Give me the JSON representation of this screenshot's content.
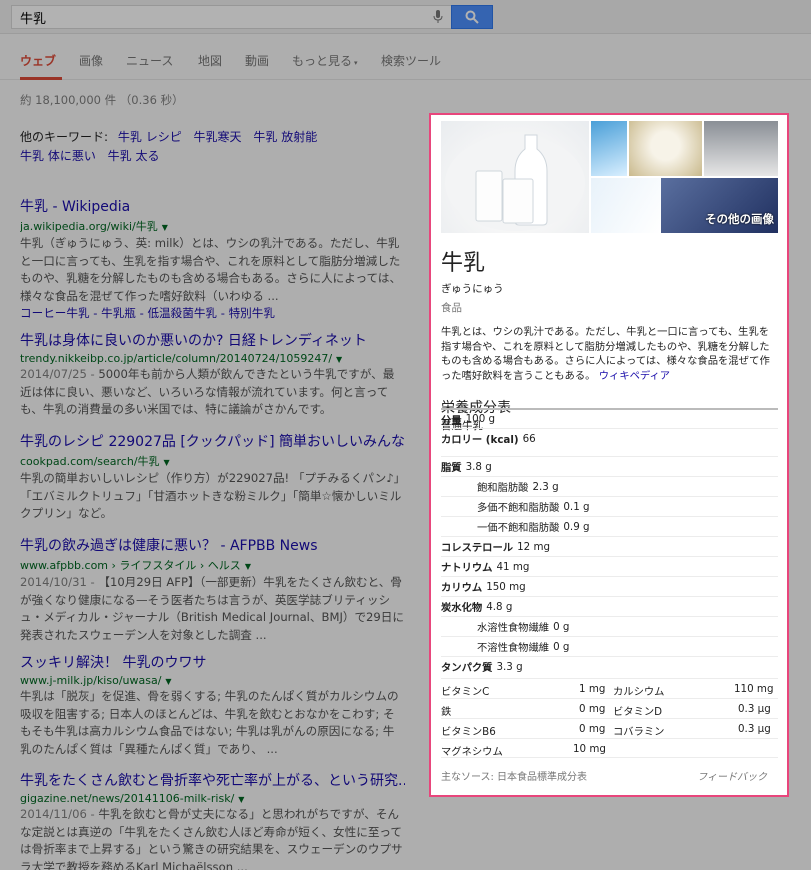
{
  "search": {
    "query": "牛乳"
  },
  "tabs": [
    {
      "label": "ウェブ"
    },
    {
      "label": "画像"
    },
    {
      "label": "ニュース"
    },
    {
      "label": "地図"
    },
    {
      "label": "動画"
    },
    {
      "label": "もっと見る"
    },
    {
      "label": "検索ツール"
    }
  ],
  "stats": "約 18,100,000 件 （0.36 秒）",
  "related": {
    "label": "他のキーワード:",
    "items": [
      "牛乳 レシピ",
      "牛乳寒天",
      "牛乳 放射能",
      "牛乳 体に悪い",
      "牛乳 太る"
    ]
  },
  "results": [
    {
      "title": "牛乳 - Wikipedia",
      "url": "ja.wikipedia.org/wiki/牛乳",
      "snippet": "牛乳（ぎゅうにゅう、英: milk）とは、ウシの乳汁である。ただし、牛乳と一口に言っても、生乳を指す場合や、これを原料として脂肪分増減したものや、乳糖を分解したものも含める場合もある。さらに人によっては、様々な食品を混ぜて作った嗜好飲料（いわゆる ...",
      "links": "コーヒー牛乳 - 牛乳瓶 - 低温殺菌牛乳 - 特別牛乳"
    },
    {
      "title": "牛乳は身体に良いのか悪いのか? 日経トレンディネット",
      "url": "trendy.nikkeibp.co.jp/article/column/20140724/1059247/",
      "date": "2014/07/25 - ",
      "snippet": "5000年も前から人類が飲んできたという牛乳ですが、最近は体に良い、悪いなど、いろいろな情報が流れています。何と言っても、牛乳の消費量の多い米国では、特に議論がさかんです。"
    },
    {
      "title": "牛乳のレシピ 229027品 [クックパッド] 簡単おいしいみんな...",
      "url": "cookpad.com/search/牛乳",
      "snippet": "牛乳の簡単おいしいレシピ（作り方）が229027品! 「プチみるくパン♪」「エバミルクトリュフ」「甘酒ホットきな粉ミルク」「簡単☆懐かしいミルクプリン」など。"
    },
    {
      "title": "牛乳の飲み過ぎは健康に悪い？ - AFPBB News",
      "url": "www.afpbb.com › ライフスタイル › ヘルス",
      "date": "2014/10/31 - ",
      "snippet": "【10月29日 AFP】（一部更新）牛乳をたくさん飲むと、骨が強くなり健康になる—そう医者たちは言うが、英医学誌ブリティッシュ・メディカル・ジャーナル（British Medical Journal、BMJ）で29日に発表されたスウェーデン人を対象とした調査 ..."
    },
    {
      "title": "スッキリ解決！ 牛乳のウワサ",
      "url": "www.j-milk.jp/kiso/uwasa/",
      "snippet": "牛乳は「脱灰」を促進、骨を弱くする; 牛乳のたんぱく質がカルシウムの吸収を阻害する; 日本人のほとんどは、牛乳を飲むとおなかをこわす; そもそも牛乳は高カルシウム食品ではない; 牛乳は乳がんの原因になる; 牛乳のたんぱく質は「異種たんぱく質」であり、 ..."
    },
    {
      "title": "牛乳をたくさん飲むと骨折率や死亡率が上がる、という研究...",
      "url": "gigazine.net/news/20141106-milk-risk/",
      "date": "2014/11/06 - ",
      "snippet": "牛乳を飲むと骨が丈夫になる」と思われがちですが、そんな定説とは真逆の「牛乳をたくさん飲む人ほど寿命が短く、女性に至っては骨折率まで上昇する」という驚きの研究結果を、スウェーデンのウプサラ大学で教授を務めるKarl Michaëlsson ..."
    }
  ],
  "kp": {
    "more_images": "その他の画像",
    "title": "牛乳",
    "reading": "ぎゅうにゅう",
    "type": "食品",
    "description": "牛乳とは、ウシの乳汁である。ただし、牛乳と一口に言っても、生乳を指す場合や、これを原料として脂肪分増減したものや、乳糖を分解したものも含める場合もある。さらに人によっては、様々な食品を混ぜて作った嗜好飲料を言うこともある。",
    "desc_link": "ウィキペディア",
    "nutrition_title": "栄養成分表",
    "nutrition_sub": "普通牛乳",
    "rows": [
      {
        "label": "分量",
        "value": "100 g",
        "bold": true
      },
      {
        "label": "カロリー (kcal)",
        "value": "66",
        "bold": true
      },
      {
        "label": "脂質",
        "value": "3.8 g",
        "bold": true
      },
      {
        "label": "飽和脂肪酸",
        "value": "2.3 g",
        "bold": false
      },
      {
        "label": "多価不飽和脂肪酸",
        "value": "0.1 g",
        "bold": false
      },
      {
        "label": "一価不飽和脂肪酸",
        "value": "0.9 g",
        "bold": false
      },
      {
        "label": "コレステロール",
        "value": "12 mg",
        "bold": true
      },
      {
        "label": "ナトリウム",
        "value": "41 mg",
        "bold": true
      },
      {
        "label": "カリウム",
        "value": "150 mg",
        "bold": true
      },
      {
        "label": "炭水化物",
        "value": "4.8 g",
        "bold": true
      },
      {
        "label": "水溶性食物繊維",
        "value": "0 g",
        "bold": false
      },
      {
        "label": "不溶性食物繊維",
        "value": "0 g",
        "bold": false
      },
      {
        "label": "タンパク質",
        "value": "3.3 g",
        "bold": true
      }
    ],
    "vitamins": [
      {
        "l1": "ビタミンC",
        "v1": "1 mg",
        "l2": "カルシウム",
        "v2": "110 mg"
      },
      {
        "l1": "鉄",
        "v1": "0 mg",
        "l2": "ビタミンD",
        "v2": "0.3 μg"
      },
      {
        "l1": "ビタミンB6",
        "v1": "0 mg",
        "l2": "コバラミン",
        "v2": "0.3 μg"
      },
      {
        "l1": "マグネシウム",
        "v1": "10 mg",
        "l2": "",
        "v2": ""
      }
    ],
    "source": "主なソース: 日本食品標準成分表",
    "feedback": "フィードバック"
  }
}
